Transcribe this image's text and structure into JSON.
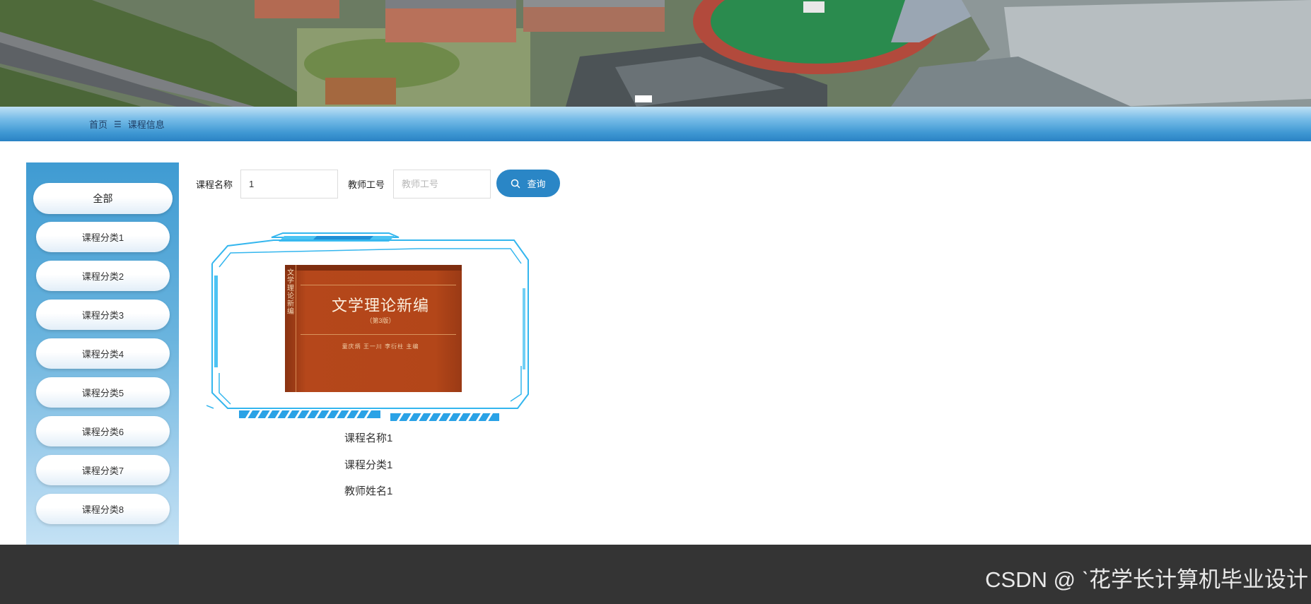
{
  "breadcrumb": {
    "home": "首页",
    "separator": "☰",
    "current": "课程信息"
  },
  "categories": [
    {
      "label": "全部",
      "active": true
    },
    {
      "label": "课程分类1"
    },
    {
      "label": "课程分类2"
    },
    {
      "label": "课程分类3"
    },
    {
      "label": "课程分类4"
    },
    {
      "label": "课程分类5"
    },
    {
      "label": "课程分类6"
    },
    {
      "label": "课程分类7"
    },
    {
      "label": "课程分类8"
    }
  ],
  "search": {
    "course_name_label": "课程名称",
    "course_name_value": "1",
    "teacher_id_label": "教师工号",
    "teacher_id_placeholder": "教师工号",
    "button_label": "查询",
    "button_icon": "search-icon"
  },
  "course": {
    "cover": {
      "title": "文学理论新编",
      "edition": "（第3版）",
      "authors": "童庆炳 王一川 李衍柱 主编",
      "spine": "文学理论新编"
    },
    "name": "课程名称1",
    "category": "课程分类1",
    "teacher": "教师姓名1"
  },
  "footer": {
    "watermark": "CSDN @ ˋ花学长计算机毕业设计"
  },
  "colors": {
    "accent": "#2a86c6",
    "frame": "#34b6ee",
    "footer": "#343434"
  }
}
